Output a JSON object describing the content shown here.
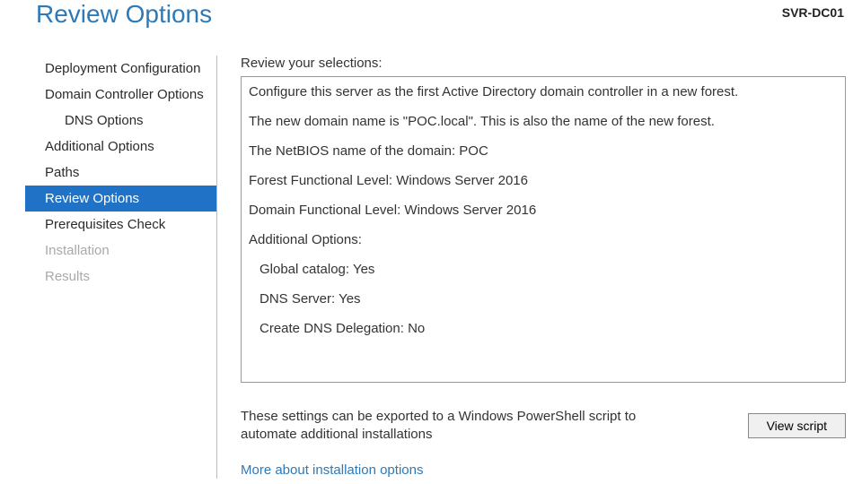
{
  "header": {
    "title": "Review Options",
    "server": "SVR-DC01"
  },
  "sidebar": {
    "items": [
      {
        "label": "Deployment Configuration",
        "selected": false,
        "disabled": false,
        "sub": false
      },
      {
        "label": "Domain Controller Options",
        "selected": false,
        "disabled": false,
        "sub": false
      },
      {
        "label": "DNS Options",
        "selected": false,
        "disabled": false,
        "sub": true
      },
      {
        "label": "Additional Options",
        "selected": false,
        "disabled": false,
        "sub": false
      },
      {
        "label": "Paths",
        "selected": false,
        "disabled": false,
        "sub": false
      },
      {
        "label": "Review Options",
        "selected": true,
        "disabled": false,
        "sub": false
      },
      {
        "label": "Prerequisites Check",
        "selected": false,
        "disabled": false,
        "sub": false
      },
      {
        "label": "Installation",
        "selected": false,
        "disabled": true,
        "sub": false
      },
      {
        "label": "Results",
        "selected": false,
        "disabled": true,
        "sub": false
      }
    ]
  },
  "main": {
    "section_label": "Review your selections:",
    "review_lines": [
      {
        "text": "Configure this server as the first Active Directory domain controller in a new forest.",
        "sub": false
      },
      {
        "text": "The new domain name is \"POC.local\". This is also the name of the new forest.",
        "sub": false
      },
      {
        "text": "The NetBIOS name of the domain: POC",
        "sub": false
      },
      {
        "text": "Forest Functional Level: Windows Server 2016",
        "sub": false
      },
      {
        "text": "Domain Functional Level: Windows Server 2016",
        "sub": false
      },
      {
        "text": "Additional Options:",
        "sub": false
      },
      {
        "text": "Global catalog: Yes",
        "sub": true
      },
      {
        "text": "DNS Server: Yes",
        "sub": true
      },
      {
        "text": "Create DNS Delegation: No",
        "sub": true
      }
    ],
    "note": "These settings can be exported to a Windows PowerShell script to automate additional installations",
    "view_script_label": "View script",
    "more_link": "More about installation options"
  }
}
